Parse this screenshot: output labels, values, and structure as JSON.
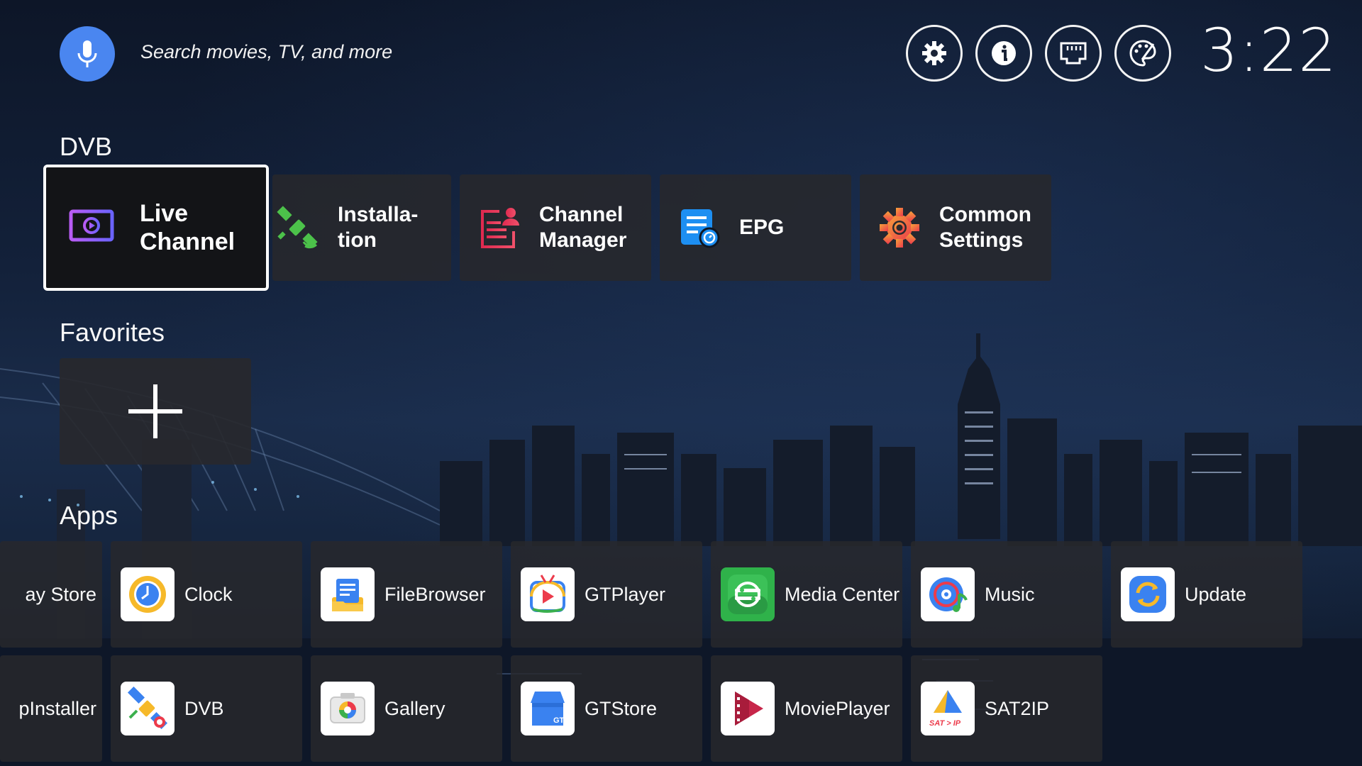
{
  "search": {
    "placeholder": "Search movies, TV, and more"
  },
  "header_icons": [
    "gear-icon",
    "info-icon",
    "ethernet-icon",
    "palette-icon"
  ],
  "clock": "3:22",
  "sections": {
    "dvb": "DVB",
    "favorites": "Favorites",
    "apps": "Apps"
  },
  "dvb_items": [
    {
      "label": "Live\nChannel",
      "icon": "live-channel-icon",
      "color": "#9a5bf2"
    },
    {
      "label": "Installa-\ntion",
      "icon": "satellite-icon",
      "color": "#4cc24a"
    },
    {
      "label": "Channel\nManager",
      "icon": "channel-manager-icon",
      "color": "#e8335a"
    },
    {
      "label": "EPG",
      "icon": "epg-icon",
      "color": "#1d8ff2"
    },
    {
      "label": "Common\nSettings",
      "icon": "settings-gear-icon",
      "color": "#f0523a"
    }
  ],
  "favorites": {
    "add_icon": "plus-icon"
  },
  "apps_row1": [
    {
      "label": "ay Store",
      "icon": "play-store-icon"
    },
    {
      "label": "Clock",
      "icon": "clock-icon"
    },
    {
      "label": "FileBrowser",
      "icon": "file-browser-icon"
    },
    {
      "label": "GTPlayer",
      "icon": "gtplayer-icon"
    },
    {
      "label": "Media Center",
      "icon": "media-center-icon"
    },
    {
      "label": "Music",
      "icon": "music-icon"
    },
    {
      "label": "Update",
      "icon": "update-icon"
    }
  ],
  "apps_row2": [
    {
      "label": "pInstaller",
      "icon": "app-installer-icon"
    },
    {
      "label": "DVB",
      "icon": "dvb-satellite-icon"
    },
    {
      "label": "Gallery",
      "icon": "gallery-icon"
    },
    {
      "label": "GTStore",
      "icon": "gtstore-icon"
    },
    {
      "label": "MoviePlayer",
      "icon": "movie-player-icon"
    },
    {
      "label": "SAT2IP",
      "icon": "sat2ip-icon"
    }
  ],
  "sat2ip_logo_text": "SAT > IP",
  "gtstore_logo_text": "GT"
}
